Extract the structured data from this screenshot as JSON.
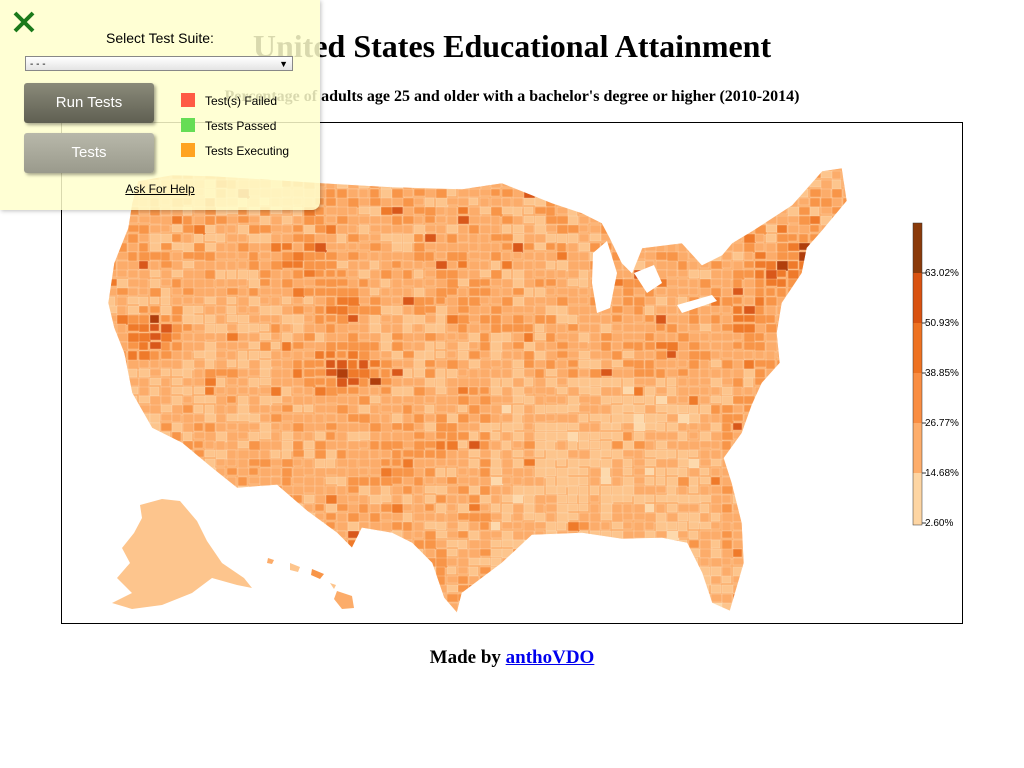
{
  "page": {
    "title": "United States Educational Attainment",
    "subtitle": "Percentage of adults age 25 and older with a bachelor's degree or higher (2010-2014)",
    "footer_prefix": "Made by ",
    "footer_link": "anthoVDO"
  },
  "legend": {
    "labels": [
      "63.02%",
      "50.93%",
      "38.85%",
      "26.77%",
      "14.68%",
      "2.60%"
    ],
    "colors": [
      "#8a3a0a",
      "#d95210",
      "#ee7221",
      "#f98d42",
      "#fdad6b",
      "#fdd5a3"
    ]
  },
  "map": {
    "palette": [
      "#fdd9ac",
      "#fdc58d",
      "#fcac6a",
      "#f89548",
      "#ef7a2a",
      "#d9581a",
      "#b03e0c"
    ],
    "land_fill": "#fdae6b"
  },
  "panel": {
    "close_icon": "close-icon",
    "select_label": "Select Test Suite:",
    "select_value": "- - -",
    "run_button": "Run Tests",
    "tests_button": "Tests",
    "statuses": [
      {
        "label": "Test(s) Failed",
        "color": "#ff5a45"
      },
      {
        "label": "Tests Passed",
        "color": "#66dd55"
      },
      {
        "label": "Tests Executing",
        "color": "#ffa320"
      }
    ],
    "help_link": "Ask For Help"
  }
}
